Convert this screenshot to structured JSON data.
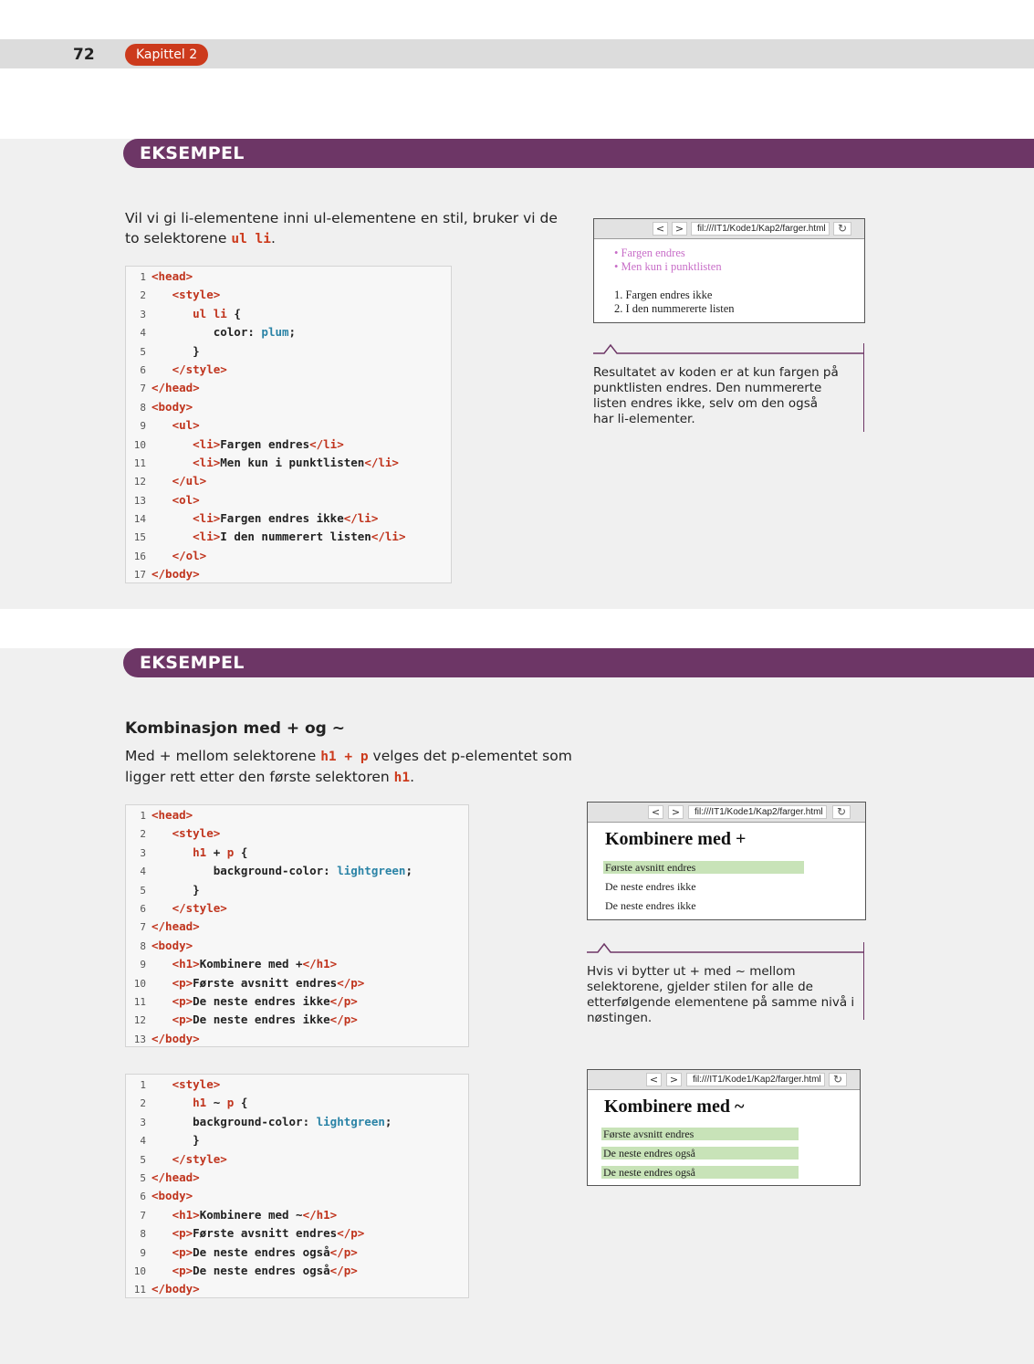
{
  "header": {
    "page_number": "72",
    "chapter": "Kapittel 2"
  },
  "example1": {
    "banner": "EKSEMPEL",
    "intro_pre": "Vil vi gi li-elementene inni ul-elementene en stil, bruker vi de to selektorene ",
    "intro_code": "ul li",
    "intro_post": ".",
    "code": [
      "<head>",
      "   <style>",
      "      ul li {",
      "         color: plum;",
      "      }",
      "   </style>",
      "</head>",
      "<body>",
      "   <ul>",
      "      <li>Fargen endres</li>",
      "      <li>Men kun i punktlisten</li>",
      "   </ul>",
      "   <ol>",
      "      <li>Fargen endres ikke</li>",
      "      <li>I den nummerert listen</li>",
      "   </ol>",
      "</body>"
    ],
    "browser": {
      "back": "<",
      "forward": ">",
      "reload": "↻",
      "url": "fil:///IT1/Kode1/Kap2/farger.html",
      "ul_items": [
        "• Fargen endres",
        "• Men kun i punktlisten"
      ],
      "ol_items": [
        "1. Fargen endres ikke",
        "2. I den nummererte listen"
      ]
    },
    "note": "Resultatet av koden er at kun fargen på punktlisten endres. Den nummererte listen endres ikke, selv om den også har li-elementer.",
    "colors": {
      "plum": "#c86ec8"
    }
  },
  "example2": {
    "banner": "EKSEMPEL",
    "heading": "Kombinasjon med + og ~",
    "intro_pre": "Med + mellom selektorene ",
    "intro_code1": "h1 + p",
    "intro_mid": " velges det p-elementet som ligger rett etter den første selektoren ",
    "intro_code2": "h1",
    "intro_post": ".",
    "code_a": [
      "<head>",
      "   <style>",
      "      h1 + p {",
      "         background-color: lightgreen;",
      "      }",
      "   </style>",
      "</head>",
      "<body>",
      "   <h1>Kombinere med +</h1>",
      "   <p>Første avsnitt endres</p>",
      "   <p>De neste endres ikke</p>",
      "   <p>De neste endres ikke</p>",
      "</body>"
    ],
    "code_b": [
      "   <style>",
      "      h1 ~ p {",
      "      background-color: lightgreen;",
      "      }",
      "   </style>",
      "</head>",
      "<body>",
      "   <h1>Kombinere med ~</h1>",
      "   <p>Første avsnitt endres</p>",
      "   <p>De neste endres også</p>",
      "   <p>De neste endres også</p>",
      "</body>"
    ],
    "code_b_numbers": [
      "1",
      "2",
      "3",
      "4",
      "5",
      "5",
      "6",
      "7",
      "8",
      "9",
      "10",
      "11"
    ],
    "browser_a": {
      "back": "<",
      "forward": ">",
      "reload": "↻",
      "url": "fil:///IT1/Kode1/Kap2/farger.html",
      "h1": "Kombinere med +",
      "p": [
        "Første avsnitt endres",
        "De neste endres ikke",
        "De neste endres ikke"
      ]
    },
    "browser_b": {
      "back": "<",
      "forward": ">",
      "reload": "↻",
      "url": "fil:///IT1/Kode1/Kap2/farger.html",
      "h1": "Kombinere med ~",
      "p": [
        "Første avsnitt endres",
        "De neste endres også",
        "De neste endres også"
      ]
    },
    "note": "Hvis vi bytter ut + med ~ mellom selektorene, gjelder stilen for alle de etterfølgende elementene på samme nivå i nøstingen.",
    "colors": {
      "lightgreen": "#c8e3b8"
    }
  },
  "colors": {
    "banner": "#6d3666",
    "chapter": "#cc3a1c",
    "tag": "#c0341d",
    "value": "#2a83a6"
  }
}
